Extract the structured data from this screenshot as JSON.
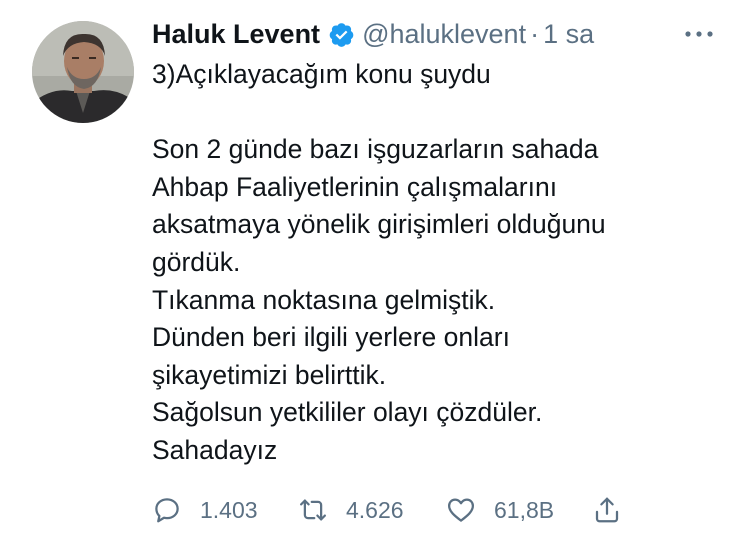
{
  "tweet": {
    "author": {
      "display_name": "Haluk Levent",
      "verified": true,
      "handle": "@haluklevent",
      "separator": "·",
      "time": "1 sa"
    },
    "text_lines": [
      "3)Açıklayacağım konu şuydu",
      "",
      "Son 2 günde bazı işguzarların sahada",
      "Ahbap Faaliyetlerinin çalışmalarını",
      "aksatmaya yönelik girişimleri olduğunu",
      "gördük.",
      "Tıkanma noktasına gelmiştik.",
      "Dünden beri ilgili yerlere onları",
      "şikayetimizi belirttik.",
      "Sağolsun yetkililer olayı çözdüler.",
      "Sahadayız"
    ],
    "actions": {
      "reply": {
        "icon": "reply-icon",
        "count": "1.403"
      },
      "retweet": {
        "icon": "retweet-icon",
        "count": "4.626"
      },
      "like": {
        "icon": "heart-icon",
        "count": "61,8B"
      },
      "share": {
        "icon": "share-icon"
      }
    }
  },
  "colors": {
    "text": "#0f1419",
    "secondary": "#5b7083",
    "verified": "#1d9bf0"
  }
}
